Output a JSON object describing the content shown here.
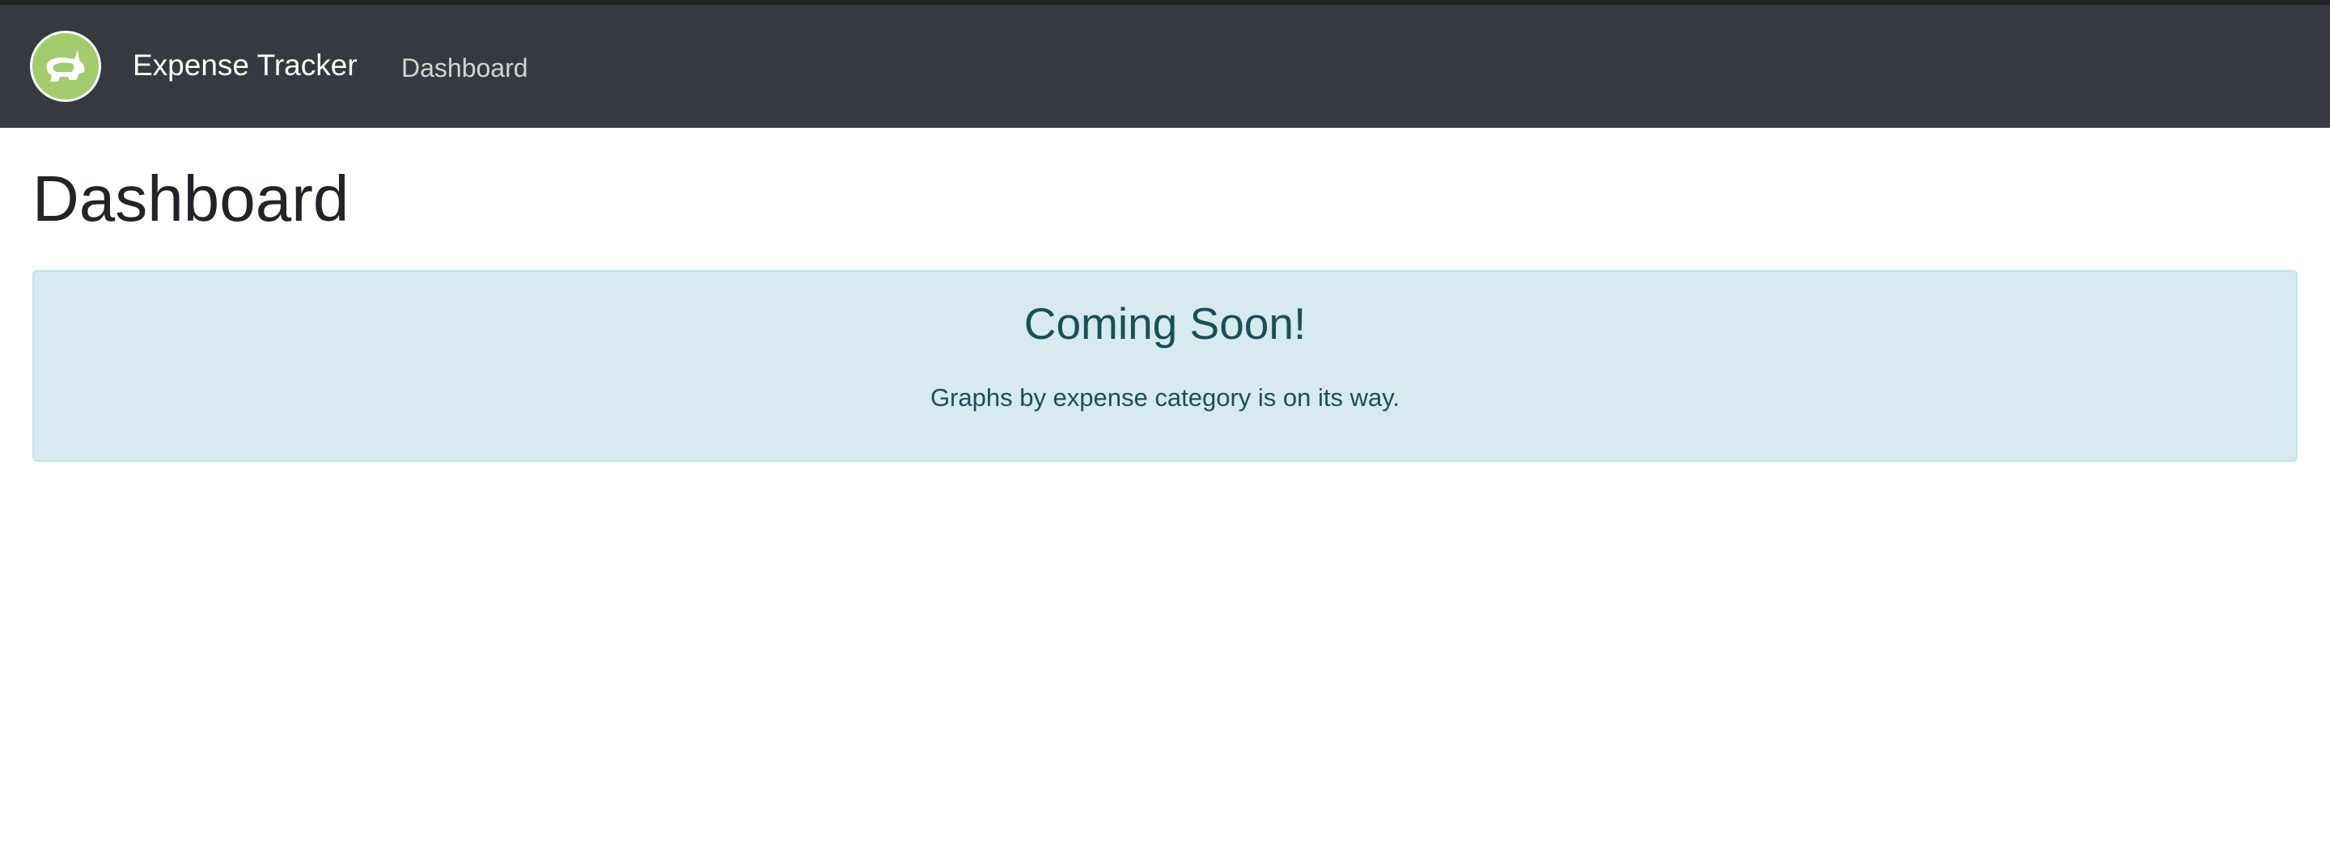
{
  "navbar": {
    "logo_icon": "piggy-bank-icon",
    "brand": "Expense Tracker",
    "links": [
      {
        "label": "Dashboard"
      }
    ]
  },
  "page": {
    "title": "Dashboard"
  },
  "alert": {
    "heading": "Coming Soon!",
    "message": "Graphs by expense category is on its way.",
    "colors": {
      "background": "#d6eaf0",
      "text": "#1b4f57"
    }
  }
}
